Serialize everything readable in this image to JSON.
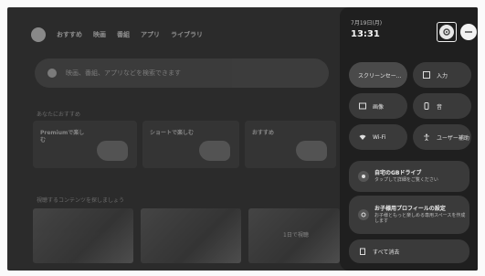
{
  "home": {
    "nav": [
      "おすすめ",
      "映画",
      "番組",
      "アプリ",
      "ライブラリ"
    ],
    "search_placeholder": "映画、番組、アプリなどを検索できます",
    "section1_title": "あなたにおすすめ",
    "section1_cards": [
      "Premiumで楽しむ",
      "ショートで楽しむ",
      "おすすめ"
    ],
    "section2_title": "視聴するコンテンツを探しましょう",
    "thumb_label": "1日で視聴"
  },
  "panel": {
    "date": "7月19日(月)",
    "time": "13:31",
    "tiles": [
      {
        "label": "スクリーンセー...",
        "icon": "screensaver-icon"
      },
      {
        "label": "入力",
        "icon": "input-icon"
      },
      {
        "label": "画像",
        "icon": "picture-icon"
      },
      {
        "label": "音",
        "icon": "sound-icon"
      },
      {
        "label": "Wi-Fi",
        "icon": "wifi-icon"
      },
      {
        "label": "ユーザー補助",
        "icon": "accessibility-icon"
      }
    ],
    "notifications": [
      {
        "title": "自宅のGBドライブ",
        "subtitle": "タップして詳細をご覧ください",
        "icon": "drive-icon"
      },
      {
        "title": "お子様用プロフィールの設定",
        "subtitle": "お子様ともっと楽しめる専用スペースを作成します",
        "icon": "profile-settings-icon"
      },
      {
        "title": "すべて消去",
        "subtitle": "",
        "icon": "clear-all-icon"
      }
    ]
  }
}
